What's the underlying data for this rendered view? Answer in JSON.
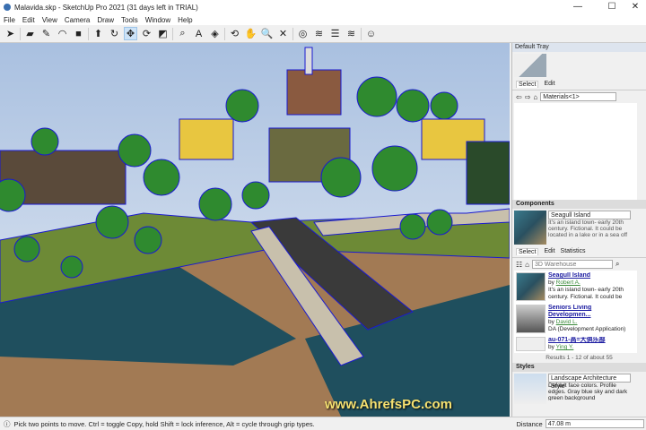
{
  "window": {
    "title": "Malavida.skp - SketchUp Pro 2021 (31 days left in TRIAL)"
  },
  "menu": [
    "File",
    "Edit",
    "View",
    "Camera",
    "Draw",
    "Tools",
    "Window",
    "Help"
  ],
  "toolbar": [
    {
      "icon": "select-arrow-icon",
      "glyph": "➤"
    },
    {
      "icon": "eraser-icon",
      "glyph": "▰"
    },
    {
      "icon": "pencil-icon",
      "glyph": "✎"
    },
    {
      "icon": "arc-icon",
      "glyph": "◠"
    },
    {
      "icon": "rectangle-icon",
      "glyph": "■"
    },
    {
      "icon": "push-pull-icon",
      "glyph": "⬆"
    },
    {
      "icon": "follow-me-icon",
      "glyph": "↻"
    },
    {
      "icon": "move-icon",
      "glyph": "✥",
      "active": true
    },
    {
      "icon": "rotate-icon",
      "glyph": "⟳"
    },
    {
      "icon": "scale-icon",
      "glyph": "◩"
    },
    {
      "icon": "tape-measure-icon",
      "glyph": "⌕"
    },
    {
      "icon": "text-icon",
      "glyph": "A"
    },
    {
      "icon": "paint-bucket-icon",
      "glyph": "◈"
    },
    {
      "icon": "orbit-icon",
      "glyph": "⟲"
    },
    {
      "icon": "pan-icon",
      "glyph": "✋"
    },
    {
      "icon": "zoom-icon",
      "glyph": "🔍"
    },
    {
      "icon": "zoom-extents-icon",
      "glyph": "✕"
    },
    {
      "icon": "3d-warehouse-icon",
      "glyph": "◎"
    },
    {
      "icon": "extension-warehouse-icon",
      "glyph": "≋"
    },
    {
      "icon": "layout-icon",
      "glyph": "☰"
    },
    {
      "icon": "extension-manager-icon",
      "glyph": "≋"
    },
    {
      "icon": "account-icon",
      "glyph": "☺"
    }
  ],
  "tray": {
    "title": "Default Tray",
    "materials": {
      "tabs": [
        "Select",
        "Edit"
      ],
      "dropdown": "Materials<1>"
    },
    "components": {
      "title": "Components",
      "name": "Seagull Island",
      "description": "It's an island town- early 20th century. Fictional. It could be located in a lake or in a sea off",
      "tabs": [
        "Select",
        "Edit",
        "Statistics"
      ],
      "search_placeholder": "3D Warehouse",
      "results": [
        {
          "title": "Seagull Island",
          "author": "Robert A.",
          "desc": "It's an island town- early 20th century. Fictional. It could be loca..."
        },
        {
          "title": "Seniors Living Developmen...",
          "author": "David L.",
          "desc": "DA (Development Application) approved Seniors Living Develop..."
        },
        {
          "title": "au-071-高=大俱乐部",
          "author": "Ying Y.",
          "desc": ""
        }
      ],
      "results_text": "Results 1 - 12 of about 55"
    },
    "styles": {
      "title": "Styles",
      "name": "Landscape Architecture Style",
      "description": "Default face colors. Profile edges. Gray blue sky and dark green background"
    }
  },
  "status": {
    "hint": "Pick two points to move.  Ctrl = toggle Copy, hold Shift = lock inference, Alt = cycle through grip types.",
    "measure_label": "Distance",
    "measure_value": "47.08 m"
  },
  "watermark": "www.AhrefsPC.com"
}
